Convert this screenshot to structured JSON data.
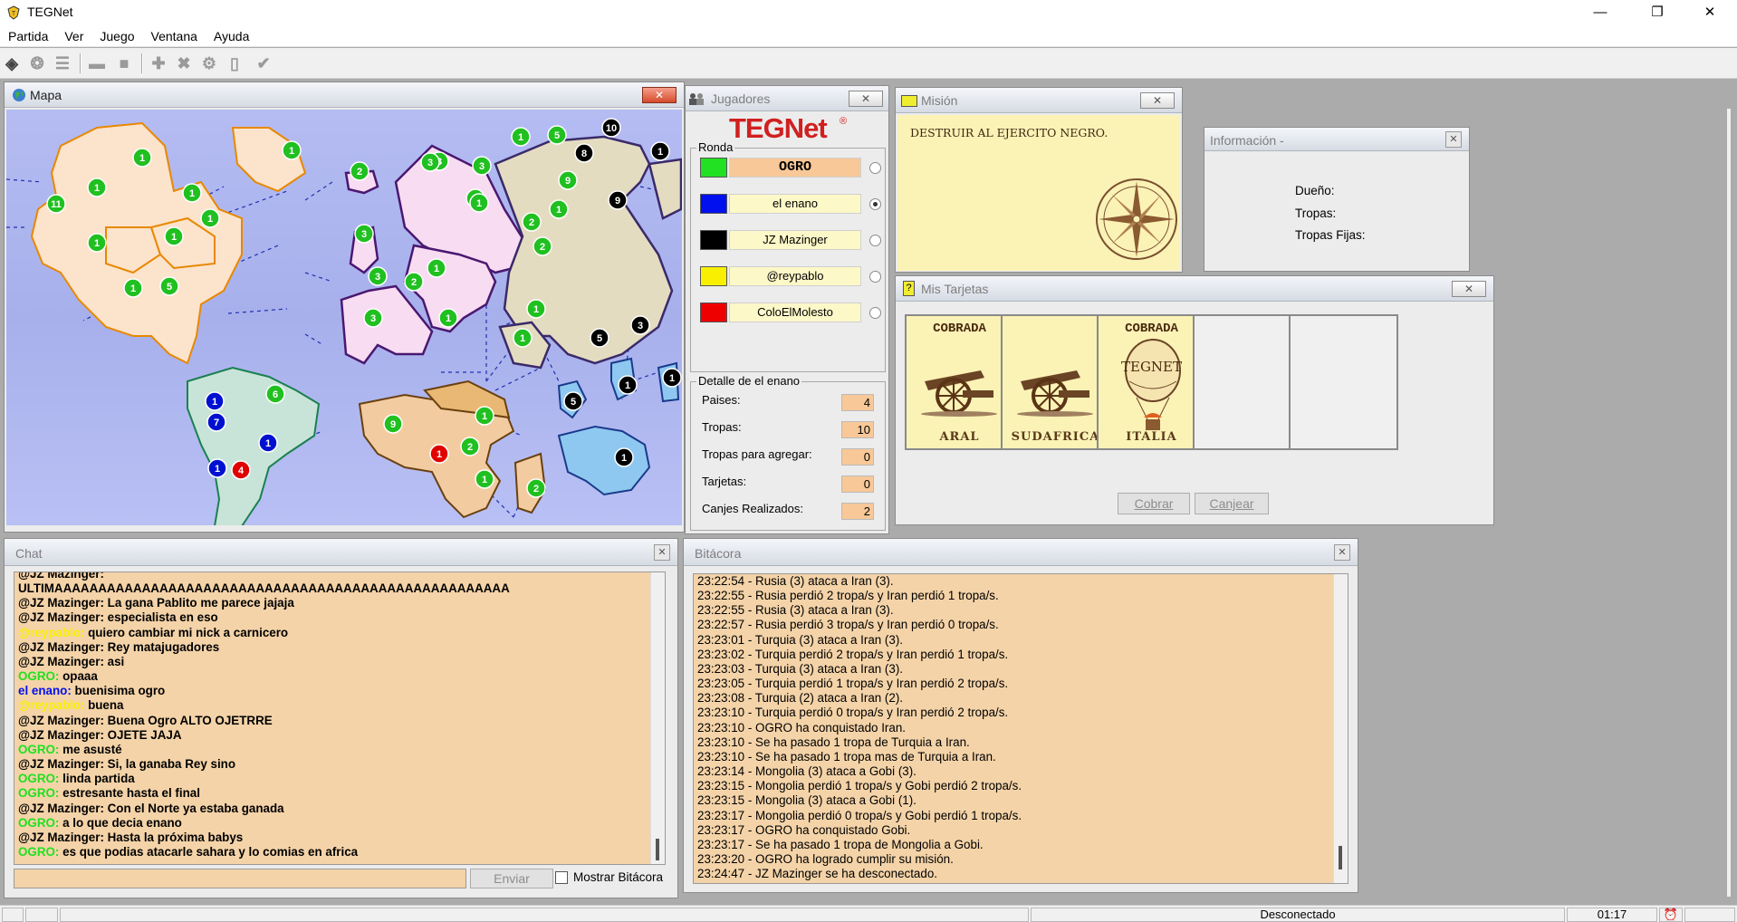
{
  "window": {
    "title": "TEGNet"
  },
  "menu": [
    "Partida",
    "Ver",
    "Juego",
    "Ventana",
    "Ayuda"
  ],
  "map": {
    "title": "Mapa"
  },
  "players": {
    "title": "Jugadores",
    "logo": "TEGNet",
    "ronda_label": "Ronda",
    "list": [
      {
        "name": "OGRO",
        "color": "#22e022",
        "bold": true,
        "active": true,
        "selected": false
      },
      {
        "name": "el enano",
        "color": "#0010ee",
        "bold": false,
        "active": false,
        "selected": true
      },
      {
        "name": "JZ Mazinger",
        "color": "#000000",
        "bold": false,
        "active": false,
        "selected": false
      },
      {
        "name": "@reypablo",
        "color": "#f8f000",
        "bold": false,
        "active": false,
        "selected": false
      },
      {
        "name": "ColoElMolesto",
        "color": "#ee0000",
        "bold": false,
        "active": false,
        "selected": false
      }
    ],
    "detail": {
      "legend": "Detalle de el enano",
      "rows": [
        {
          "label": "Paises:",
          "value": "4"
        },
        {
          "label": "Tropas:",
          "value": "10"
        },
        {
          "label": "Tropas para agregar:",
          "value": "0"
        },
        {
          "label": "Tarjetas:",
          "value": "0"
        },
        {
          "label": "Canjes Realizados:",
          "value": "2"
        }
      ]
    }
  },
  "mission": {
    "title": "Misión",
    "text": "DESTRUIR AL EJERCITO NEGRO."
  },
  "info": {
    "title": "Información -",
    "fields": [
      {
        "label": "Dueño:"
      },
      {
        "label": "Tropas:"
      },
      {
        "label": "Tropas Fijas:"
      }
    ]
  },
  "cards": {
    "title": "Mis Tarjetas",
    "items": [
      {
        "status": "COBRADA",
        "name": "ARAL",
        "type": "cannon"
      },
      {
        "status": "",
        "name": "SUDAFRICA",
        "type": "cannon"
      },
      {
        "status": "COBRADA",
        "name": "ITALIA",
        "type": "balloon"
      }
    ],
    "balloon_text": "TEGNET",
    "cobrar": "Cobrar",
    "canjear": "Canjear"
  },
  "chat": {
    "title": "Chat",
    "send": "Enviar",
    "show_log": "Mostrar Bitácora",
    "messages": [
      {
        "user": "@JZ Mazinger:",
        "color": "#000000",
        "text": ""
      },
      {
        "user": "",
        "color": "#000000",
        "text": "ULTIMAAAAAAAAAAAAAAAAAAAAAAAAAAAAAAAAAAAAAAAAAAAAAAAAAAAA"
      },
      {
        "user": "@JZ Mazinger:",
        "color": "#000000",
        "text": "La gana Pablito me parece jajaja"
      },
      {
        "user": "@JZ Mazinger:",
        "color": "#000000",
        "text": "especialista en eso"
      },
      {
        "user": "@reypablo:",
        "color": "#f8f000",
        "text": "quiero cambiar mi nick a carnicero"
      },
      {
        "user": "@JZ Mazinger:",
        "color": "#000000",
        "text": "Rey matajugadores"
      },
      {
        "user": "@JZ Mazinger:",
        "color": "#000000",
        "text": "asi"
      },
      {
        "user": "OGRO:",
        "color": "#22e022",
        "text": "opaaa"
      },
      {
        "user": "el enano:",
        "color": "#0010ee",
        "text": "buenisima ogro"
      },
      {
        "user": "@reypablo:",
        "color": "#f8f000",
        "text": "buena"
      },
      {
        "user": "@JZ Mazinger:",
        "color": "#000000",
        "text": "Buena Ogro ALTO OJETRRE"
      },
      {
        "user": "@JZ Mazinger:",
        "color": "#000000",
        "text": "OJETE JAJA"
      },
      {
        "user": "OGRO:",
        "color": "#22e022",
        "text": "me asusté"
      },
      {
        "user": "@JZ Mazinger:",
        "color": "#000000",
        "text": "Si, la ganaba Rey sino"
      },
      {
        "user": "OGRO:",
        "color": "#22e022",
        "text": "linda partida"
      },
      {
        "user": "OGRO:",
        "color": "#22e022",
        "text": "estresante hasta el final"
      },
      {
        "user": "@JZ Mazinger:",
        "color": "#000000",
        "text": "Con el Norte ya estaba ganada"
      },
      {
        "user": "OGRO:",
        "color": "#22e022",
        "text": "a lo que decia enano"
      },
      {
        "user": "@JZ Mazinger:",
        "color": "#000000",
        "text": "Hasta la próxima babys"
      },
      {
        "user": "OGRO:",
        "color": "#22e022",
        "text": "es que podias atacarle sahara y lo comias en africa"
      }
    ]
  },
  "log": {
    "title": "Bitácora",
    "lines": [
      "23:22:54 - Rusia (3) ataca a Iran (3).",
      "23:22:55 - Rusia perdió 2 tropa/s y Iran perdió 1 tropa/s.",
      "23:22:55 - Rusia (3) ataca a Iran (3).",
      "23:22:57 - Rusia perdió 3 tropa/s y Iran perdió 0 tropa/s.",
      "23:23:01 - Turquia (3) ataca a Iran (3).",
      "23:23:02 - Turquia perdió 2 tropa/s y Iran perdió 1 tropa/s.",
      "23:23:03 - Turquia (3) ataca a Iran (3).",
      "23:23:05 - Turquia perdió 1 tropa/s y Iran perdió 2 tropa/s.",
      "23:23:08 - Turquia (2) ataca a Iran (2).",
      "23:23:10 - Turquia perdió 0 tropa/s y Iran perdió 2 tropa/s.",
      "23:23:10 - OGRO ha conquistado Iran.",
      "23:23:10 - Se ha pasado 1 tropa de Turquia a Iran.",
      "23:23:10 - Se ha pasado 1 tropa mas de Turquia a Iran.",
      "23:23:14 - Mongolia (3) ataca a Gobi (3).",
      "23:23:15 - Mongolia perdió 1 tropa/s y Gobi perdió 2 tropa/s.",
      "23:23:15 - Mongolia (3) ataca a Gobi (1).",
      "23:23:17 - Mongolia perdió 0 tropa/s y Gobi perdió 1 tropa/s.",
      "23:23:17 - OGRO ha conquistado Gobi.",
      "23:23:17 - Se ha pasado 1 tropa de Mongolia a Gobi.",
      "23:23:20 - OGRO ha logrado cumplir su misión.",
      "23:24:47 - JZ Mazinger se ha desconectado."
    ]
  },
  "status": {
    "connection": "Desconectado",
    "time": "01:17"
  },
  "map_armies": [
    {
      "owner": "green",
      "count": "1"
    },
    {
      "owner": "green",
      "count": "1"
    },
    {
      "owner": "green",
      "count": "11"
    },
    {
      "owner": "green",
      "count": "1"
    },
    {
      "owner": "green",
      "count": "1"
    },
    {
      "owner": "green",
      "count": "1"
    },
    {
      "owner": "green",
      "count": "1"
    },
    {
      "owner": "green",
      "count": "1"
    },
    {
      "owner": "green",
      "count": "5"
    },
    {
      "owner": "green",
      "count": "1"
    },
    {
      "owner": "green",
      "count": "2"
    },
    {
      "owner": "green",
      "count": "3"
    },
    {
      "owner": "green",
      "count": "3"
    },
    {
      "owner": "green",
      "count": "1"
    },
    {
      "owner": "green",
      "count": "5"
    },
    {
      "owner": "black",
      "count": "10"
    },
    {
      "owner": "black",
      "count": "1"
    },
    {
      "owner": "green",
      "count": "3"
    },
    {
      "owner": "black",
      "count": "8"
    },
    {
      "owner": "green",
      "count": "1"
    },
    {
      "owner": "green",
      "count": "9"
    },
    {
      "owner": "black",
      "count": "9"
    },
    {
      "owner": "green",
      "count": "2"
    },
    {
      "owner": "green",
      "count": "1"
    },
    {
      "owner": "green",
      "count": "3"
    },
    {
      "owner": "green",
      "count": "3"
    },
    {
      "owner": "green",
      "count": "1"
    },
    {
      "owner": "green",
      "count": "1"
    },
    {
      "owner": "green",
      "count": "2"
    },
    {
      "owner": "green",
      "count": "1"
    },
    {
      "owner": "green",
      "count": "2"
    },
    {
      "owner": "green",
      "count": "3"
    },
    {
      "owner": "green",
      "count": "1"
    },
    {
      "owner": "green",
      "count": "1"
    },
    {
      "owner": "black",
      "count": "5"
    },
    {
      "owner": "black",
      "count": "3"
    },
    {
      "owner": "blue",
      "count": "1"
    },
    {
      "owner": "green",
      "count": "6"
    },
    {
      "owner": "blue",
      "count": "7"
    },
    {
      "owner": "blue",
      "count": "1"
    },
    {
      "owner": "blue",
      "count": "1"
    },
    {
      "owner": "red",
      "count": "4"
    },
    {
      "owner": "green",
      "count": "9"
    },
    {
      "owner": "green",
      "count": "1"
    },
    {
      "owner": "green",
      "count": "2"
    },
    {
      "owner": "red",
      "count": "1"
    },
    {
      "owner": "green",
      "count": "1"
    },
    {
      "owner": "green",
      "count": "2"
    },
    {
      "owner": "black",
      "count": "1"
    },
    {
      "owner": "black",
      "count": "5"
    },
    {
      "owner": "black",
      "count": "1"
    },
    {
      "owner": "black",
      "count": "1"
    }
  ]
}
